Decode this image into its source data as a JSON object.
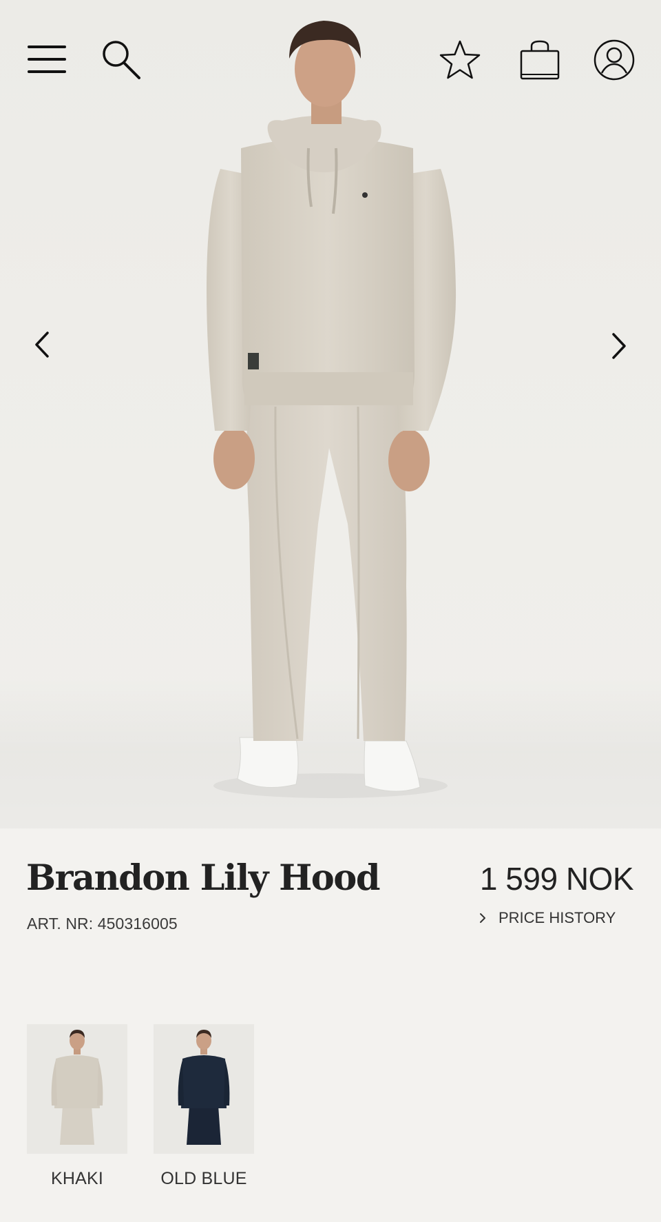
{
  "header": {
    "icons": [
      "menu-icon",
      "search-icon",
      "favorite-star-icon",
      "shopping-bag-icon",
      "account-icon"
    ]
  },
  "gallery": {
    "prev_icon": "chevron-left-icon",
    "next_icon": "chevron-right-icon"
  },
  "product": {
    "title": "Brandon Lily Hood",
    "art_nr": "ART. NR: 450316005",
    "price": "1 599 NOK",
    "price_history_label": "PRICE HISTORY"
  },
  "variants": [
    {
      "label": "KHAKI",
      "color": "#d3cdc1"
    },
    {
      "label": "OLD BLUE",
      "color": "#1e2a3c"
    }
  ],
  "colors": {
    "background": "#f3f2ef",
    "hero_background": "#ecebe7",
    "garment_khaki": "#d8d2c7",
    "text": "#222222"
  }
}
